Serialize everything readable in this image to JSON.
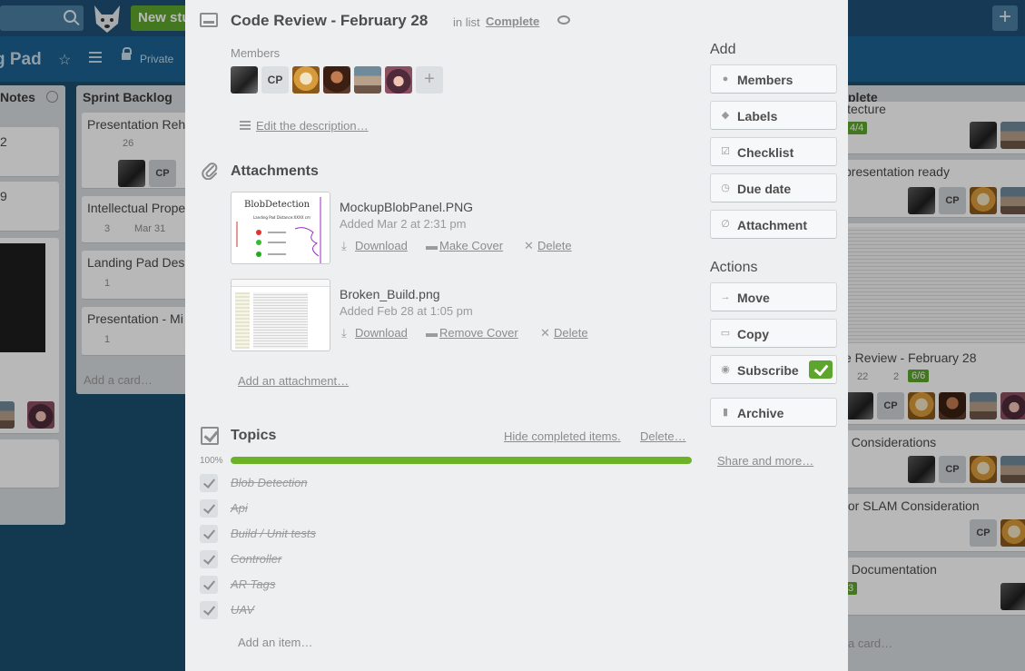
{
  "background": {
    "new_stuff": "New stu",
    "board_name": "g Pad",
    "visibility": "Private",
    "lists": [
      {
        "title": "Notes"
      },
      {
        "title": "Sprint Backlog",
        "cards": [
          {
            "title": "Presentation Reh",
            "comments": "26"
          },
          {
            "title": "Intellectual Prope",
            "comments": "3",
            "due": "Mar 31"
          },
          {
            "title": "Landing Pad Des",
            "comments": "1"
          },
          {
            "title": "Presentation - Mi",
            "comments": "1"
          }
        ],
        "add_card": "Add a card…"
      },
      {
        "title": "plete",
        "cards": [
          {
            "title": "itecture",
            "check": "4/4"
          },
          {
            "title": "presentation ready"
          },
          {
            "title": "e Review - February 28",
            "comments": "22",
            "attachments": "2",
            "check": "6/6"
          },
          {
            "title": "/ Considerations"
          },
          {
            "title": "tor SLAM Consideration"
          },
          {
            "title": "t Documentation",
            "check": "3"
          }
        ],
        "add_card": "a card…"
      }
    ],
    "left_card_numbers": [
      "2",
      "9"
    ]
  },
  "modal": {
    "title": "Code Review - February 28",
    "in_list_prefix": "in list",
    "list_name": "Complete",
    "members_label": "Members",
    "members": [
      {
        "type": "avatar",
        "style": "dark"
      },
      {
        "type": "initials",
        "text": "CP"
      },
      {
        "type": "avatar",
        "style": "dog"
      },
      {
        "type": "avatar",
        "style": "woman"
      },
      {
        "type": "avatar",
        "style": "hat"
      },
      {
        "type": "avatar",
        "style": "girl"
      }
    ],
    "add_member": "+",
    "edit_description": "Edit the description…",
    "attachments_title": "Attachments",
    "attachments": [
      {
        "name": "MockupBlobPanel.PNG",
        "added": "Added Mar 2 at 2:31 pm",
        "download": "Download",
        "cover": "Make Cover",
        "delete": "Delete"
      },
      {
        "name": "Broken_Build.png",
        "added": "Added Feb 28 at 1:05 pm",
        "download": "Download",
        "cover": "Remove Cover",
        "delete": "Delete"
      }
    ],
    "thumb_text": {
      "title": "BlobDetection",
      "subtitle": "Landing Pad Distance:XXXX cm"
    },
    "add_attachment": "Add an attachment…",
    "checklist": {
      "title": "Topics",
      "hide_completed": "Hide completed items.",
      "delete": "Delete…",
      "progress_label": "100%",
      "progress": 1.0,
      "items": [
        "Blob Detection",
        "Api",
        "Build / Unit tests",
        "Controller",
        "AR Tags",
        "UAV"
      ],
      "add_item": "Add an item…"
    },
    "sidebar": {
      "add_heading": "Add",
      "add_buttons": [
        {
          "label": "Members",
          "icon": "person-icon"
        },
        {
          "label": "Labels",
          "icon": "tag-icon"
        },
        {
          "label": "Checklist",
          "icon": "checkbox-icon"
        },
        {
          "label": "Due date",
          "icon": "clock-icon"
        },
        {
          "label": "Attachment",
          "icon": "paperclip-icon"
        }
      ],
      "actions_heading": "Actions",
      "action_buttons": [
        {
          "label": "Move",
          "icon": "arrow-right-icon"
        },
        {
          "label": "Copy",
          "icon": "card-icon"
        },
        {
          "label": "Subscribe",
          "icon": "eye-icon",
          "checked": true
        },
        {
          "label": "Archive",
          "icon": "trash-icon"
        }
      ],
      "share_more": "Share and more…"
    }
  },
  "colors": {
    "accent_green": "#5da52d",
    "progress_green": "#6bb227",
    "board_blue": "#1b4f70"
  }
}
